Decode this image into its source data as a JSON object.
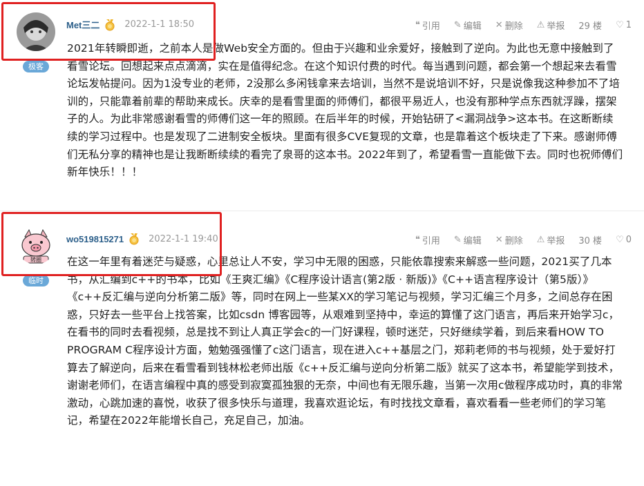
{
  "posts": [
    {
      "username": "Met三二",
      "badge": "极客",
      "date": "2022-1-1 18:50",
      "actions": {
        "quote": "引用",
        "edit": "编辑",
        "delete": "删除",
        "report": "举报"
      },
      "floor": "29 楼",
      "likes": "1",
      "content": "2021年转瞬即逝，之前本人是做Web安全方面的。但由于兴趣和业余爱好，接触到了逆向。为此也无意中接触到了看雪论坛。回想起来点点滴滴，实在是值得纪念。在这个知识付费的时代。每当遇到问题，都会第一个想起来去看雪论坛发帖提问。因为1没专业的老师，2没那么多闲钱拿来去培训，当然不是说培训不好，只是说像我这种参加不了培训的，只能靠着前辈的帮助来成长。庆幸的是看雪里面的师傅们，都很平易近人，也没有那种学点东西就浮躁，摆架子的人。为此非常感谢看雪的师傅们这一年的照顾。在后半年的时候，开始钻研了<漏洞战争>这本书。在这断断续续的学习过程中。也是发现了二进制安全板块。里面有很多CVE复现的文章，也是靠着这个板块走了下来。感谢师傅们无私分享的精神也是让我断断续续的看完了泉哥的这本书。2022年到了，希望看雪一直能做下去。同时也祝师傅们新年快乐！！！"
    },
    {
      "username": "wo519815271",
      "badge": "临时",
      "date": "2022-1-1 19:40",
      "actions": {
        "quote": "引用",
        "edit": "编辑",
        "delete": "删除",
        "report": "举报"
      },
      "floor": "30 楼",
      "likes": "0",
      "avatar_text": "转圈",
      "content": "在这一年里有着迷茫与疑惑，心里总让人不安，学习中无限的困惑，只能依靠搜索来解惑一些问题，2021买了几本书，从汇编到c++的书本，比如《王爽汇编》《C程序设计语言(第2版 · 新版)》《C++语言程序设计（第5版）》《c++反汇编与逆向分析第二版》等，同时在网上一些某XX的学习笔记与视频，学习汇编三个月多，之间总存在困惑，只好去一些平台上找答案，比如csdn 博客园等，从艰难到坚持中，幸运的算懂了这门语言，再后来开始学习c，在看书的同时去看视频，总是找不到让人真正学会c的一门好课程，顿时迷茫，只好继续学着，到后来看HOW TO PROGRAM C程序设计方面，勉勉强强懂了c这门语言，现在进入c++基层之门，郑莉老师的书与视频，处于爱好打算去了解逆向，后来在看雪看到钱林松老师出版《c++反汇编与逆向分析第二版》就买了这本书，希望能学到技术，谢谢老师们，在语言编程中真的感受到寂寞孤独狠的无奈，中间也有无限乐趣，当第一次用c做程序成功时，真的非常激动，心跳加速的喜悦，收获了很多快乐与道理，我喜欢逛论坛，有时找找文章看，喜欢看看一些老师们的学习笔记，希望在2022年能增长自己，充足自己，加油。"
    }
  ],
  "colors": {
    "username": "#2c5f8a",
    "badge": "#6aa8d8",
    "highlight": "#e02020",
    "meta": "#999999"
  },
  "icons": [
    "quote-icon",
    "edit-icon",
    "delete-icon",
    "report-icon",
    "like-icon",
    "medal-icon"
  ]
}
